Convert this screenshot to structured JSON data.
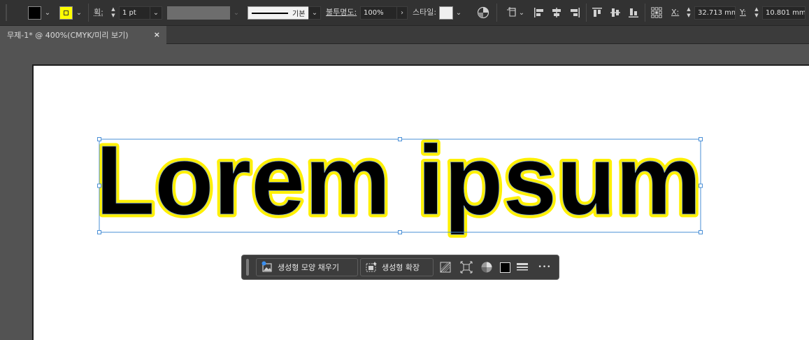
{
  "control_bar": {
    "fill_color": "#000000",
    "stroke_color": "#ffff00",
    "stroke_label": "획:",
    "stroke_weight": "1 pt",
    "stroke_style": "기본",
    "opacity_label": "불투명도:",
    "opacity": "100%",
    "style_label": "스타일:",
    "x_label": "X:",
    "x_value": "32.713 mm",
    "y_label": "Y:",
    "y_value": "10.801 mm"
  },
  "document_tab": {
    "title": "무제-1* @ 400%(CMYK/미리 보기)",
    "close_glyph": "×"
  },
  "artboard": {
    "text": "Lorem ipsum",
    "text_fill": "#000000",
    "text_stroke": "#fff000"
  },
  "task_bar": {
    "generative_shape_fill_label": "생성형 모양 채우기",
    "generative_expand_label": "생성형 확장",
    "more_glyph": "•••"
  },
  "colors": {
    "chrome_dark": "#323232",
    "canvas": "#535353",
    "selection": "#4a8fd6"
  }
}
